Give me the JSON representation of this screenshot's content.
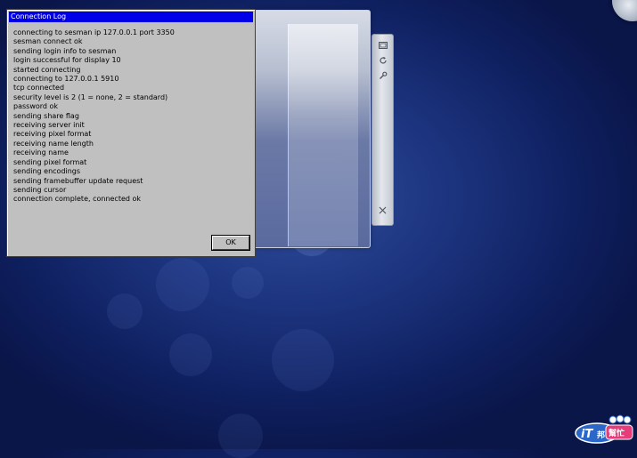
{
  "dialog": {
    "title": "Connection Log",
    "lines": [
      "connecting to sesman ip 127.0.0.1 port 3350",
      "sesman connect ok",
      "sending login info to sesman",
      "login successful for display 10",
      "started connecting",
      "connecting to 127.0.0.1 5910",
      "tcp connected",
      "security level is 2 (1 = none, 2 = standard)",
      "password ok",
      "sending share flag",
      "receiving server init",
      "receiving pixel format",
      "receiving name length",
      "receiving name",
      "sending pixel format",
      "sending encodings",
      "sending framebuffer update request",
      "sending cursor",
      "connection complete, connected ok"
    ],
    "ok_label": "OK"
  },
  "side_toolbar": {
    "icons": [
      "resize-icon",
      "refresh-icon",
      "wrench-icon",
      "close-icon"
    ]
  },
  "watermark": {
    "logo_text": "iT邦幫忙"
  },
  "colors": {
    "titlebar": "#0000e8",
    "dialog_bg": "#c0c0c0",
    "desktop": "#1d3580"
  }
}
